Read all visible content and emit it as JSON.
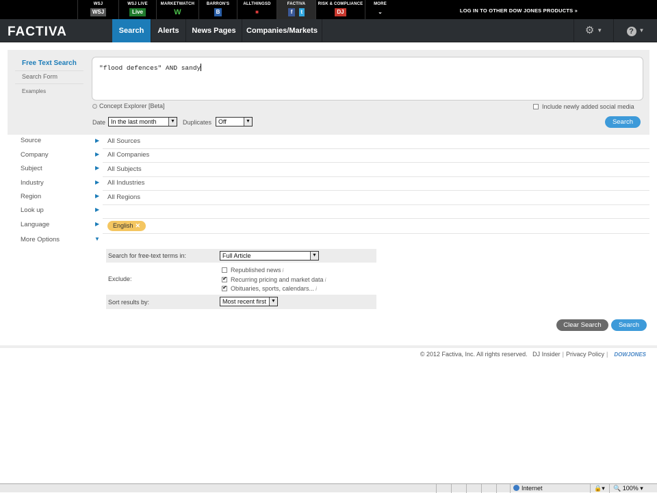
{
  "dj_bar": {
    "products": [
      {
        "label": "WSJ",
        "logo": "WSJ"
      },
      {
        "label": "WSJ LIVE",
        "logo": "Live"
      },
      {
        "label": "MARKETWATCH",
        "logo": "W"
      },
      {
        "label": "BARRON'S",
        "logo": "B"
      },
      {
        "label": "ALLTHINGSD",
        "logo": "■"
      },
      {
        "label": "FACTIVA",
        "logo": "f"
      },
      {
        "label": "RISK & COMPLIANCE",
        "logo": "DJ"
      },
      {
        "label": "MORE",
        "logo": "⌄"
      }
    ],
    "login_link": "LOG IN TO OTHER DOW JONES PRODUCTS »"
  },
  "nav": {
    "logo": "FACTIVA",
    "tabs": [
      "Search",
      "Alerts",
      "News Pages",
      "Companies/Markets"
    ],
    "settings_icon": "gear-icon",
    "help_icon": "help-icon"
  },
  "search": {
    "side_links": {
      "free_text": "Free Text Search",
      "search_form": "Search Form",
      "examples": "Examples"
    },
    "query": "\"flood defences\" AND sandy",
    "concept_explorer": "Concept Explorer [Beta]",
    "social_media": "Include newly added social media",
    "date_label": "Date",
    "date_value": "In the last month",
    "duplicates_label": "Duplicates",
    "duplicates_value": "Off",
    "search_button": "Search"
  },
  "filters": [
    {
      "label": "Source",
      "value": "All Sources"
    },
    {
      "label": "Company",
      "value": "All Companies"
    },
    {
      "label": "Subject",
      "value": "All Subjects"
    },
    {
      "label": "Industry",
      "value": "All Industries"
    },
    {
      "label": "Region",
      "value": "All Regions"
    },
    {
      "label": "Look up",
      "value": ""
    },
    {
      "label": "Language",
      "value": ""
    },
    {
      "label": "More Options",
      "value": ""
    }
  ],
  "language_tag": "English",
  "more_options": {
    "free_text_label": "Search for free-text terms in:",
    "free_text_value": "Full Article",
    "exclude_label": "Exclude:",
    "exclude_items": [
      {
        "label": "Republished news",
        "checked": false
      },
      {
        "label": "Recurring pricing and market data",
        "checked": true
      },
      {
        "label": "Obituaries, sports, calendars...",
        "checked": true
      }
    ],
    "sort_label": "Sort results by:",
    "sort_value": "Most recent first"
  },
  "actions": {
    "clear": "Clear Search",
    "search": "Search"
  },
  "footer": {
    "copyright": "© 2012 Factiva, Inc. All rights reserved.",
    "dj_insider": "DJ Insider",
    "privacy": "Privacy Policy",
    "brand": "DOWJONES"
  },
  "statusbar": {
    "zone": "Internet",
    "zoom": "100%"
  }
}
